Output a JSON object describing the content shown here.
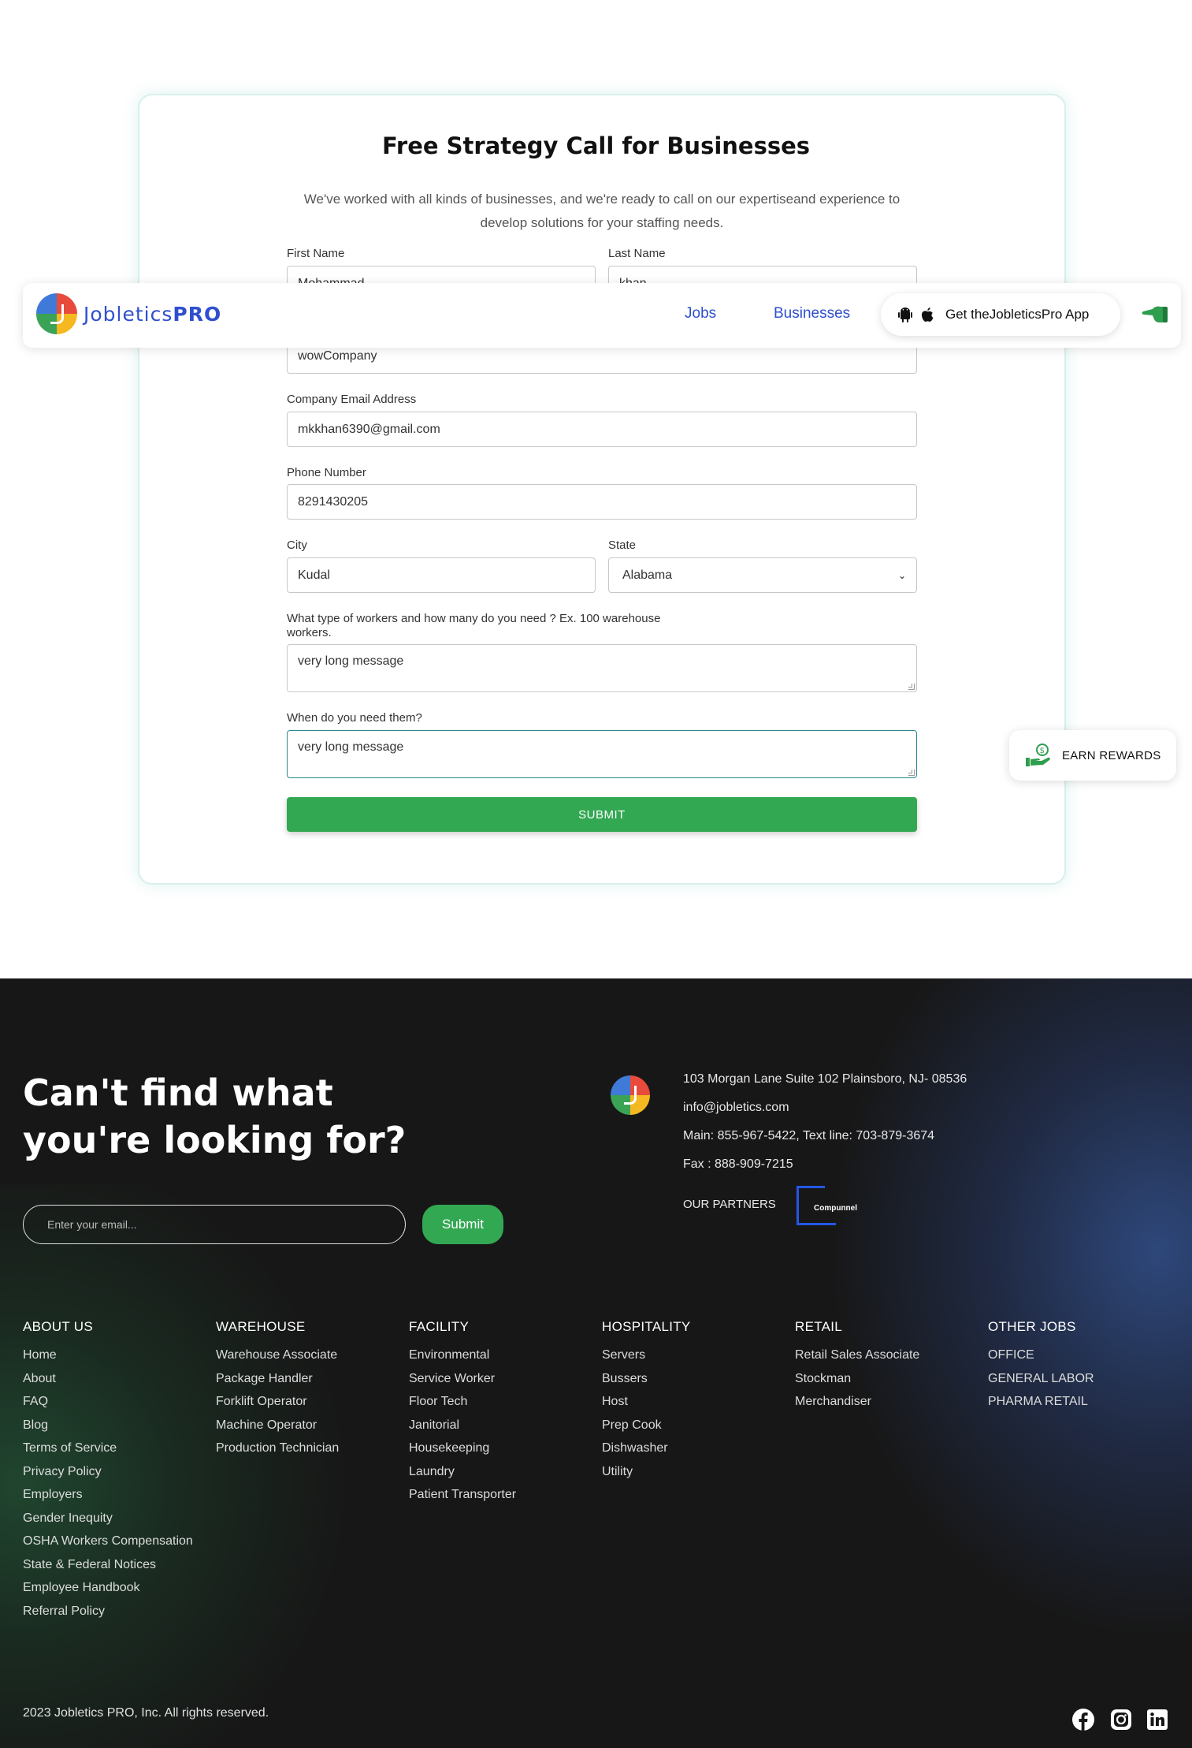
{
  "form": {
    "title": "Free Strategy Call for Businesses",
    "subtitle": "We've worked with all kinds of businesses, and we're ready to call on our expertiseand experience to develop solutions for your staffing needs.",
    "first_name": {
      "label": "First Name",
      "value": "Mohammad"
    },
    "last_name": {
      "label": "Last Name",
      "value": "khan"
    },
    "company": {
      "value": "wowCompany"
    },
    "email": {
      "label": "Company Email Address",
      "value": "mkkhan6390@gmail.com"
    },
    "phone": {
      "label": "Phone Number",
      "value": "8291430205"
    },
    "city": {
      "label": "City",
      "value": "Kudal"
    },
    "state": {
      "label": "State",
      "value": "Alabama"
    },
    "workers": {
      "label": "What type of workers and how many do you need ? Ex. 100 warehouse workers.",
      "value": "very long message"
    },
    "when": {
      "label": "When do you need them?",
      "value": "very long message"
    },
    "submit_label": "SUBMIT"
  },
  "navbar": {
    "logo_main": "Jobletics",
    "logo_accent": "PRO",
    "jobs": "Jobs",
    "businesses": "Businesses",
    "app_button": "Get theJobleticsPro App"
  },
  "rewards": {
    "label": "EARN REWARDS"
  },
  "footer": {
    "heading": "Can't find what you're looking for?",
    "email_placeholder": "Enter your email...",
    "email_submit": "Submit",
    "address": "103 Morgan Lane Suite 102 Plainsboro, NJ- 08536",
    "email": "info@jobletics.com",
    "phones": "Main: 855-967-5422, Text line: 703-879-3674",
    "fax": "Fax : 888-909-7215",
    "partners_label": "OUR PARTNERS",
    "partner_name": "Compunnel",
    "columns": [
      {
        "title": "ABOUT US",
        "items": [
          "Home",
          "About",
          "FAQ",
          "Blog",
          "Terms of Service",
          "Privacy Policy",
          "Employers",
          "Gender Inequity",
          "OSHA Workers Compensation",
          "State & Federal Notices",
          "Employee Handbook",
          "Referral Policy"
        ]
      },
      {
        "title": "WAREHOUSE",
        "items": [
          "Warehouse Associate",
          "Package Handler",
          "Forklift Operator",
          "Machine Operator",
          "Production Technician"
        ]
      },
      {
        "title": "FACILITY",
        "items": [
          "Environmental",
          "Service Worker",
          "Floor Tech",
          "Janitorial",
          "Housekeeping",
          "Laundry",
          "Patient Transporter"
        ]
      },
      {
        "title": "HOSPITALITY",
        "items": [
          "Servers",
          "Bussers",
          "Host",
          "Prep Cook",
          "Dishwasher",
          "Utility"
        ]
      },
      {
        "title": "RETAIL",
        "items": [
          "Retail Sales Associate",
          "Stockman",
          "Merchandiser"
        ]
      },
      {
        "title": "OTHER JOBS",
        "items": [
          "OFFICE",
          "GENERAL LABOR",
          "PHARMA RETAIL"
        ]
      }
    ],
    "copyright": "2023 Jobletics PRO, Inc. All rights reserved.",
    "social": [
      "facebook-icon",
      "instagram-icon",
      "linkedin-icon"
    ]
  },
  "colors": {
    "brand_blue": "#2f4fcf",
    "brand_green": "#33a853",
    "footer_bg": "#171717"
  }
}
